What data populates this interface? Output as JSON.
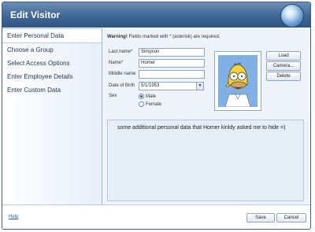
{
  "window": {
    "title": "Edit Visitor"
  },
  "sidebar": {
    "items": [
      {
        "label": "Enter Personal Data"
      },
      {
        "label": "Choose a Group"
      },
      {
        "label": "Select Access Options"
      },
      {
        "label": "Enter Employee Details"
      },
      {
        "label": "Enter Custom Data"
      }
    ]
  },
  "form": {
    "warning_prefix": "Warning!",
    "warning_text": "Fields marked with * (asterisk) are required.",
    "last_name_label": "Last name*",
    "last_name_value": "Simpson",
    "name_label": "Name*",
    "name_value": "Homer",
    "middle_name_label": "Middle name",
    "middle_name_value": "",
    "dob_label": "Date of Birth",
    "dob_value": "5/1/1953",
    "sex_label": "Sex",
    "sex_options": [
      "Male",
      "Female"
    ],
    "sex_selected": "Male"
  },
  "photo_buttons": {
    "load": "Load",
    "camera": "Camera...",
    "delete": "Delete"
  },
  "notes": {
    "text": "some additional personal data that Homer kinldy asked me to hide =)"
  },
  "footer": {
    "help": "Help",
    "save": "Save",
    "cancel": "Cancel"
  }
}
